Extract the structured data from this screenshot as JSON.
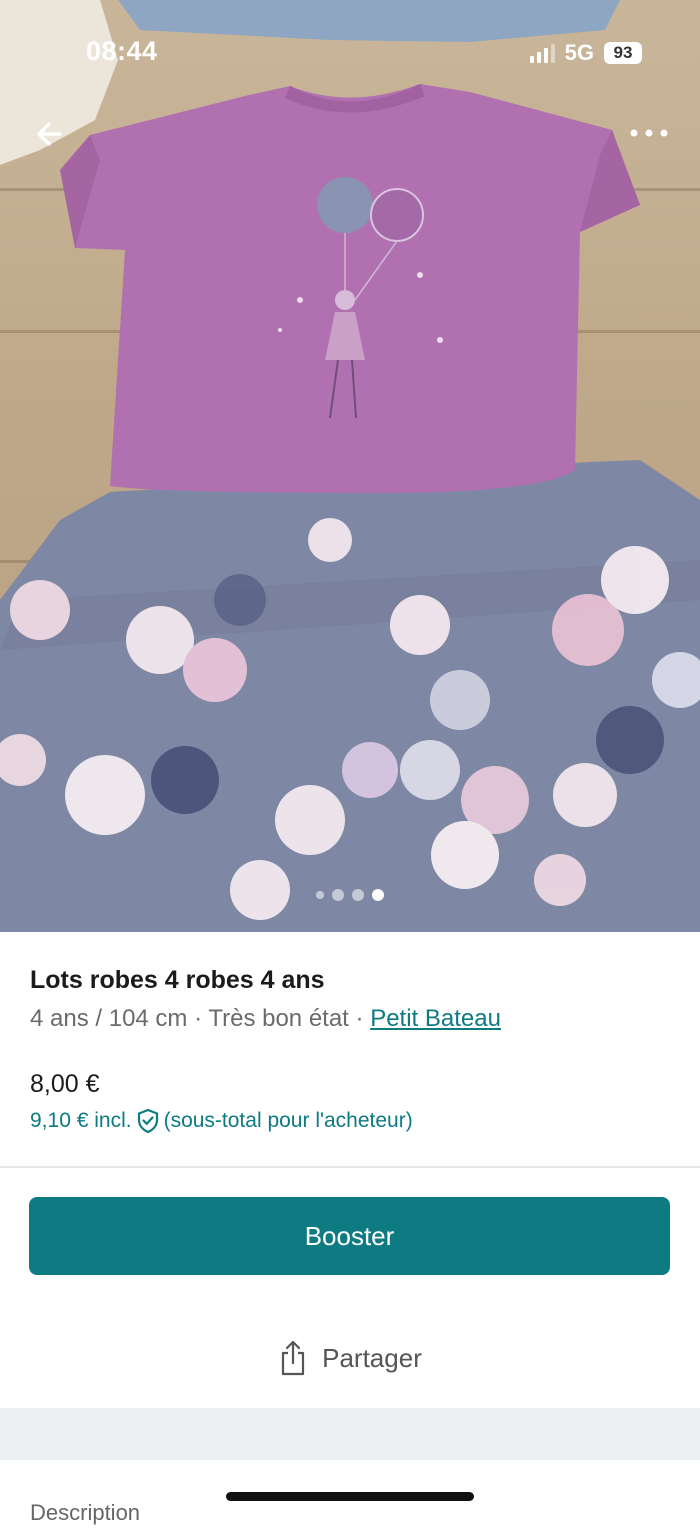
{
  "status_bar": {
    "time": "08:44",
    "network": "5G",
    "battery": "93"
  },
  "photo": {
    "page_count": 4,
    "current_page": 4
  },
  "item": {
    "title": "Lots robes 4 robes  4 ans",
    "size": "4 ans / 104 cm",
    "separator": " · ",
    "condition": "Très bon état",
    "brand": "Petit Bateau",
    "price": "8,00 €",
    "buyer_price": "9,10 € incl.",
    "buyer_price_note": "(sous-total pour l'acheteur)"
  },
  "actions": {
    "booster_label": "Booster",
    "share_label": "Partager"
  },
  "description": {
    "heading": "Description"
  },
  "colors": {
    "accent": "#0e7a82",
    "text": "#1b1b1b",
    "muted": "#6b6b6b"
  },
  "icons": [
    "back-arrow-icon",
    "more-options-icon",
    "signal-icon",
    "battery-icon",
    "shield-check-icon",
    "share-icon"
  ]
}
